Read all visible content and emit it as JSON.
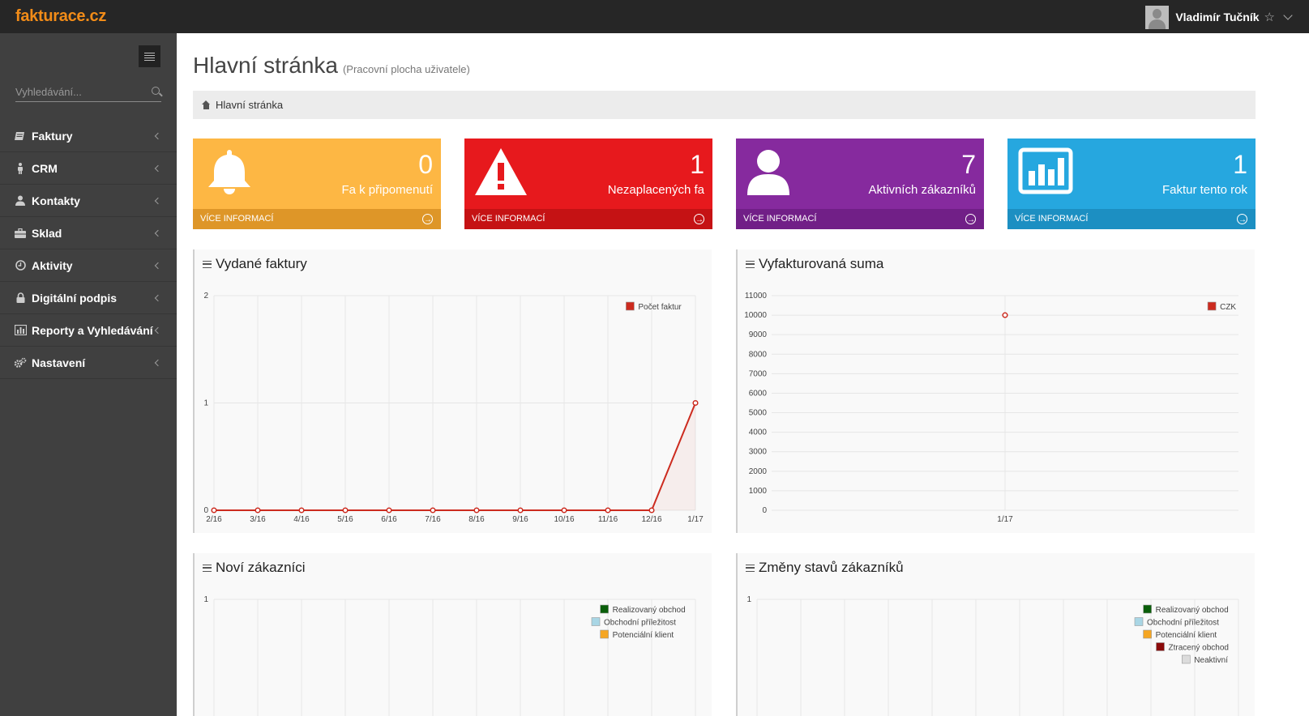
{
  "app": {
    "logo": "fakturace.cz"
  },
  "user": {
    "name": "Vladimír Tučník"
  },
  "sidebar": {
    "search_placeholder": "Vyhledávání...",
    "items": [
      {
        "label": "Faktury",
        "icon": "book-icon"
      },
      {
        "label": "CRM",
        "icon": "person-icon"
      },
      {
        "label": "Kontakty",
        "icon": "user-icon"
      },
      {
        "label": "Sklad",
        "icon": "briefcase-icon"
      },
      {
        "label": "Aktivity",
        "icon": "clock-icon"
      },
      {
        "label": "Digitální podpis",
        "icon": "lock-icon"
      },
      {
        "label": "Reporty a Vyhledávání",
        "icon": "bar-chart-icon"
      },
      {
        "label": "Nastavení",
        "icon": "gears-icon"
      }
    ]
  },
  "page": {
    "title": "Hlavní stránka",
    "subtitle": "(Pracovní plocha uživatele)"
  },
  "breadcrumb": {
    "label": "Hlavní stránka"
  },
  "boxes": [
    {
      "number": "0",
      "label": "Fa k připomenutí",
      "footer": "VÍCE INFORMACÍ",
      "icon": "bell-icon",
      "color": "#fdb744",
      "footer_color": "#de9628"
    },
    {
      "number": "1",
      "label": "Nezaplacených fa",
      "footer": "VÍCE INFORMACÍ",
      "icon": "warning-icon",
      "color": "#e7191d",
      "footer_color": "#c51214"
    },
    {
      "number": "7",
      "label": "Aktivních zákazníků",
      "footer": "VÍCE INFORMACÍ",
      "icon": "user-icon",
      "color": "#862a9e",
      "footer_color": "#711f87"
    },
    {
      "number": "1",
      "label": "Faktur tento rok",
      "footer": "VÍCE INFORMACÍ",
      "icon": "bar-chart-icon",
      "color": "#26a7df",
      "footer_color": "#1c8fc2"
    }
  ],
  "panels": {
    "issued": {
      "title": "Vydané faktury"
    },
    "sum": {
      "title": "Vyfakturovaná suma"
    },
    "new_customers": {
      "title": "Noví zákazníci"
    },
    "status_changes": {
      "title": "Změny stavů zákazníků"
    }
  },
  "chart_data": [
    {
      "type": "line",
      "categories": [
        "2/16",
        "3/16",
        "4/16",
        "5/16",
        "6/16",
        "7/16",
        "8/16",
        "9/16",
        "10/16",
        "11/16",
        "12/16",
        "1/17"
      ],
      "series": [
        {
          "name": "Počet faktur",
          "values": [
            0,
            0,
            0,
            0,
            0,
            0,
            0,
            0,
            0,
            0,
            0,
            1
          ],
          "color": "#cc2b1f"
        }
      ],
      "ylim": [
        0,
        2
      ],
      "yticks": [
        "0",
        "1",
        "2"
      ],
      "legend": "top-right",
      "grid": true
    },
    {
      "type": "scatter",
      "categories": [
        "1/17"
      ],
      "series": [
        {
          "name": "CZK",
          "values": [
            10000
          ],
          "color": "#cc2b1f"
        }
      ],
      "ylim": [
        0,
        11000
      ],
      "yticks": [
        "0",
        "1000",
        "2000",
        "3000",
        "4000",
        "5000",
        "6000",
        "7000",
        "8000",
        "9000",
        "10000",
        "11000"
      ],
      "legend": "top-right",
      "grid": true
    },
    {
      "type": "line",
      "yticks": [
        "1"
      ],
      "legend_entries": [
        {
          "name": "Realizovaný obchod",
          "color": "#0a5e0a"
        },
        {
          "name": "Obchodní příležitost",
          "color": "#a9d6e5"
        },
        {
          "name": "Potenciální klient",
          "color": "#f5a623"
        }
      ],
      "legend": "top-right",
      "grid": true
    },
    {
      "type": "line",
      "yticks": [
        "1"
      ],
      "legend_entries": [
        {
          "name": "Realizovaný obchod",
          "color": "#0a5e0a"
        },
        {
          "name": "Obchodní příležitost",
          "color": "#a9d6e5"
        },
        {
          "name": "Potenciální klient",
          "color": "#f5a623"
        },
        {
          "name": "Ztracený obchod",
          "color": "#8b0a0a"
        },
        {
          "name": "Neaktivní",
          "color": "#dcdcdc"
        }
      ],
      "legend": "top-right",
      "grid": true
    }
  ]
}
